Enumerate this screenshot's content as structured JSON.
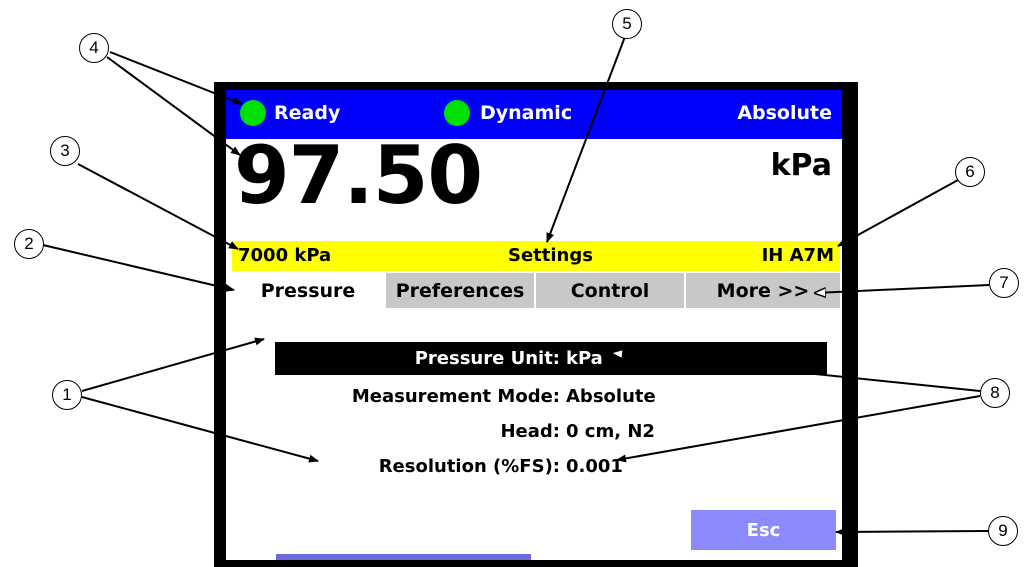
{
  "status_bar": {
    "ready_label": "Ready",
    "dynamic_label": "Dynamic",
    "mode_label": "Absolute",
    "bg_color": "#0000ff",
    "indicator_color": "#00e000"
  },
  "reading": {
    "value": "97.50",
    "unit": "kPa"
  },
  "info_bar": {
    "range": "7000 kPa",
    "title": "Settings",
    "sensor": "IH A7M",
    "bg_color": "#ffff00"
  },
  "tabs": [
    {
      "label": "Pressure",
      "active": true
    },
    {
      "label": "Preferences",
      "active": false
    },
    {
      "label": "Control",
      "active": false
    },
    {
      "label": "More >>",
      "active": false
    }
  ],
  "settings": [
    {
      "label": "Pressure Unit:",
      "value": "kPa",
      "selected": true
    },
    {
      "label": "Measurement Mode:",
      "value": "Absolute",
      "selected": false
    },
    {
      "label": "Head:",
      "value": "0 cm, N2",
      "selected": false
    },
    {
      "label": "Resolution (%FS):",
      "value": "0.001",
      "selected": false
    }
  ],
  "esc_label": "Esc",
  "callouts": [
    "1",
    "2",
    "3",
    "4",
    "5",
    "6",
    "7",
    "8",
    "9"
  ]
}
